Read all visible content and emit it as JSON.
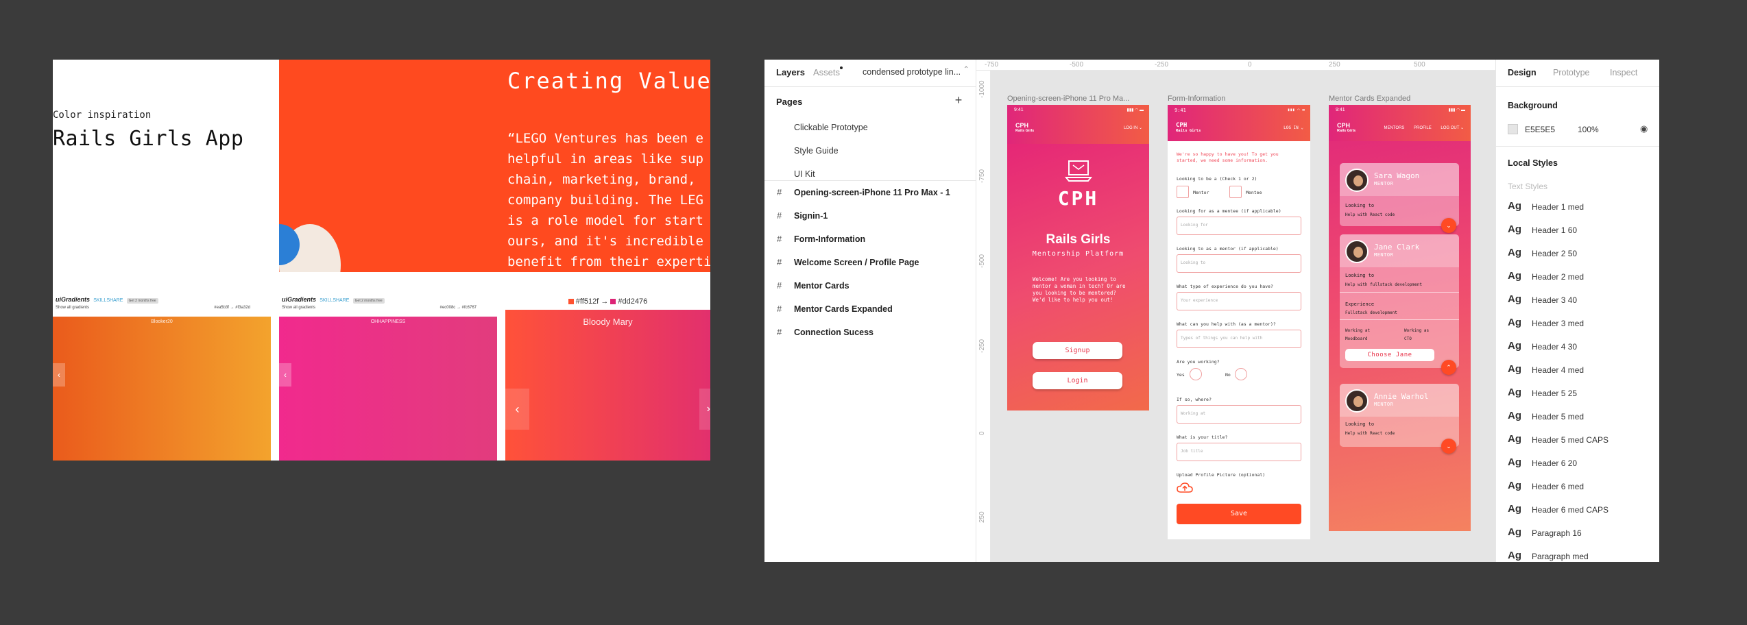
{
  "moodboard": {
    "color_inspiration": "Color inspiration",
    "rails_title": "Rails Girls App",
    "lego_title": "Creating Value",
    "lego_quote": "“LEGO Ventures has been e\nhelpful in areas like sup\nchain, marketing, brand, \ncompany building. The LEG\nis a role model for start\nours, and it's incredible\nbenefit from their experti",
    "cards": [
      {
        "logo": "uiGradients",
        "skill": "SKILLSHARE",
        "chip": "Get 2 months free",
        "sub": "Show all gradients",
        "codes": "#ea5b3f → #f3a32d",
        "name": "Blooker20",
        "arrow": "‹"
      },
      {
        "logo": "uiGradients",
        "skill": "SKILLSHARE",
        "chip": "Get 2 months free",
        "sub": "Show all gradients",
        "codes": "#ec008c → #fc6767",
        "name": "OHHAPPINESS",
        "arrow": "‹"
      },
      {
        "codes_left": "#ff512f",
        "codes_right": "#dd2476",
        "name": "Bloody Mary",
        "arrow_left": "‹",
        "arrow_right": "›"
      }
    ],
    "colors": {
      "swatch_left": "#ff512f",
      "swatch_right": "#dd2476"
    }
  },
  "layers_panel": {
    "tabs": {
      "layers": "Layers",
      "assets": "Assets"
    },
    "page_name": "condensed prototype lin...",
    "page_chevron": "⌃",
    "pages_label": "Pages",
    "add_icon": "+",
    "pages": [
      "Clickable Prototype",
      "Style Guide",
      "UI Kit"
    ],
    "hash": "#",
    "layers": [
      "Opening-screen-iPhone 11 Pro Max - 1",
      "Signin-1",
      "Form-Information",
      "Welcome Screen / Profile Page",
      "Mentor Cards",
      "Mentor Cards Expanded",
      "Connection Sucess"
    ]
  },
  "rulers": {
    "top": [
      "-750",
      "-500",
      "-250",
      "0",
      "250",
      "500"
    ],
    "left": [
      "-1000",
      "-750",
      "-500",
      "-250",
      "0",
      "250"
    ]
  },
  "frames": {
    "labels": [
      "Opening-screen-iPhone 11 Pro Ma...",
      "Form-Information",
      "Mentor Cards Expanded"
    ],
    "status_time": "9:41",
    "status_icons": "▮▮▮ ◠ ▬",
    "nav_logo": "CPH",
    "nav_logo_sub": "Rails Girls",
    "phone1": {
      "nav_links": [
        "LOG IN ⌄"
      ],
      "cph": "CPH",
      "rails_girls": "Rails Girls",
      "mentorship": "Mentorship Platform",
      "welcome": "Welcome! Are you looking to mentor a woman in tech? Or are you looking to be mentored? We'd like to help you out!",
      "signup": "Signup",
      "login": "Login"
    },
    "phone2": {
      "nav_links": [
        "LOG IN ⌄"
      ],
      "intro": "We're so happy to have you! To get you started, we need some information.",
      "q1": "Looking to be a (Check 1 or 2)",
      "opt_mentor": "Mentor",
      "opt_mentee": "Mentee",
      "q2": "Looking for as a mentee (if applicable)",
      "ph2": "Looking for",
      "q3": "Looking to as a mentor (if applicable)",
      "ph3": "Looking to",
      "q4": "What type of experience do you have?",
      "ph4": "Your experience",
      "q5": "What can you help with (as a mentor)?",
      "ph5": "Types of things you can help with",
      "q6": "Are you working?",
      "yes": "Yes",
      "no": "No",
      "q7": "If so, where?",
      "ph7": "Working at",
      "q8": "What is your title?",
      "ph8": "Job title",
      "q9": "Upload Profile Picture (optional)",
      "save": "Save"
    },
    "phone3": {
      "nav_links": [
        "MENTORS",
        "PROFILE",
        "LOG OUT ⌄"
      ],
      "cards": [
        {
          "name": "Sara Wagon",
          "role": "MENTOR",
          "l1": "Looking to",
          "l2": "Help with React code",
          "chip": "⌄"
        },
        {
          "name": "Jane Clark",
          "role": "MENTOR",
          "l1": "Looking to",
          "l2": "Help with fullstack development",
          "l3": "Experience",
          "l4": "Fullstack development",
          "l5": "Working at",
          "l6": "Moodboard",
          "l7": "Working as",
          "l8": "CTO",
          "choose": "Choose Jane",
          "chip": "⌃"
        },
        {
          "name": "Annie Warhol",
          "role": "MENTOR",
          "l1": "Looking to",
          "l2": "Help with React code",
          "chip": "⌄"
        }
      ]
    }
  },
  "design_panel": {
    "tabs": {
      "design": "Design",
      "prototype": "Prototype",
      "inspect": "Inspect"
    },
    "background_label": "Background",
    "bg_hex": "E5E5E5",
    "bg_opacity": "100%",
    "eye_icon": "◉",
    "local_styles_label": "Local Styles",
    "text_styles_label": "Text Styles",
    "ag": "Ag",
    "styles": [
      "Header 1 med",
      "Header 1 60",
      "Header 2 50",
      "Header 2 med",
      "Header 3 40",
      "Header 3 med",
      "Header 4 30",
      "Header 4 med",
      "Header 5 25",
      "Header 5 med",
      "Header 5 med CAPS",
      "Header 6 20",
      "Header 6 med",
      "Header 6 med CAPS",
      "Paragraph 16",
      "Paragraph med"
    ]
  },
  "colors": {
    "canvas_bg": "#3b3b3b",
    "figma_canvas": "#e5e5e5",
    "accent_orange": "#ff4a24",
    "accent_pink": "#e0267a"
  }
}
